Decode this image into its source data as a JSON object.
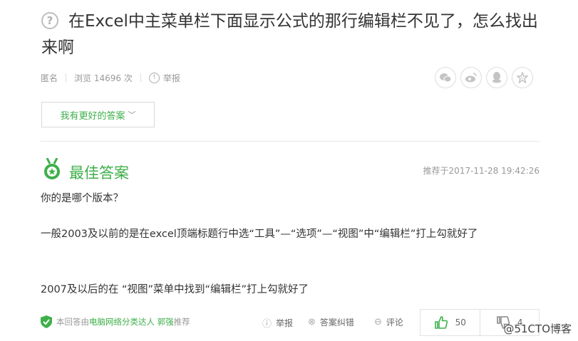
{
  "question": {
    "icon": "question-circle-icon",
    "title": "在Excel中主菜单栏下面显示公式的那行编辑栏不见了，怎么找出来啊"
  },
  "meta": {
    "author": "匿名",
    "views": "浏览 14696 次",
    "report": "举报"
  },
  "share_icons": [
    "wechat-icon",
    "weibo-icon",
    "qq-icon",
    "star-icon"
  ],
  "better_answer_button": "我有更好的答案",
  "best_answer": {
    "label": "最佳答案",
    "recommended_time": "推荐于2017-11-28 19:42:26",
    "paragraphs": [
      "你的是哪个版本？",
      "一般2003及以前的是在excel顶端标题行中选“工具”—“选项”—“视图”中“编辑栏”打上勾就好了",
      "2007及以后的在 “视图”菜单中找到“编辑栏”打上勾就好了"
    ]
  },
  "footer": {
    "note_prefix": "本回答由",
    "note_highlight": "电脑网络分类达人 郭强",
    "note_suffix": "推荐",
    "report": "举报",
    "correct": "答案纠错",
    "comment": "评论",
    "like_count": "50",
    "dislike_count": "4"
  },
  "watermark": "@51CTO博客",
  "colors": {
    "accent_green": "#3eaf4a",
    "text": "#333333",
    "muted": "#999999"
  }
}
